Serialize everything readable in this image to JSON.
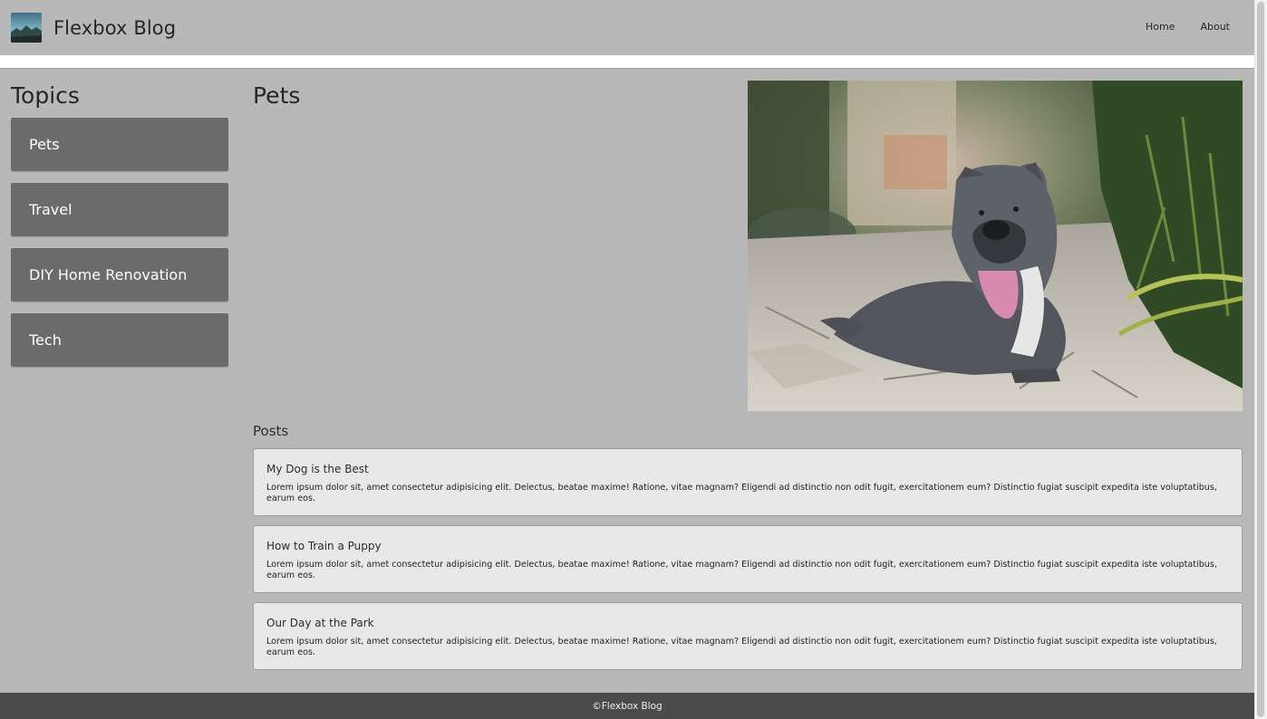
{
  "header": {
    "site_title": "Flexbox Blog",
    "nav": [
      {
        "label": "Home"
      },
      {
        "label": "About"
      }
    ]
  },
  "sidebar": {
    "heading": "Topics",
    "topics": [
      {
        "label": "Pets"
      },
      {
        "label": "Travel"
      },
      {
        "label": "DIY Home Renovation"
      },
      {
        "label": "Tech"
      }
    ]
  },
  "main": {
    "title": "Pets",
    "hero_image": "dog-photo",
    "posts_heading": "Posts",
    "posts": [
      {
        "title": "My Dog is the Best",
        "body": "Lorem ipsum dolor sit, amet consectetur adipisicing elit. Delectus, beatae maxime! Ratione, vitae magnam? Eligendi ad distinctio non odit fugit, exercitationem eum? Distinctio fugiat suscipit expedita iste voluptatibus, earum eos."
      },
      {
        "title": "How to Train a Puppy",
        "body": "Lorem ipsum dolor sit, amet consectetur adipisicing elit. Delectus, beatae maxime! Ratione, vitae magnam? Eligendi ad distinctio non odit fugit, exercitationem eum? Distinctio fugiat suscipit expedita iste voluptatibus, earum eos."
      },
      {
        "title": "Our Day at the Park",
        "body": "Lorem ipsum dolor sit, amet consectetur adipisicing elit. Delectus, beatae maxime! Ratione, vitae magnam? Eligendi ad distinctio non odit fugit, exercitationem eum? Distinctio fugiat suscipit expedita iste voluptatibus, earum eos."
      }
    ]
  },
  "footer": {
    "text": "©Flexbox Blog"
  },
  "colors": {
    "page_bg": "#b8b8b8",
    "topic_button": "#6b6b6b",
    "post_card": "#e8e8e8",
    "footer_bg": "#4b4b4b"
  }
}
